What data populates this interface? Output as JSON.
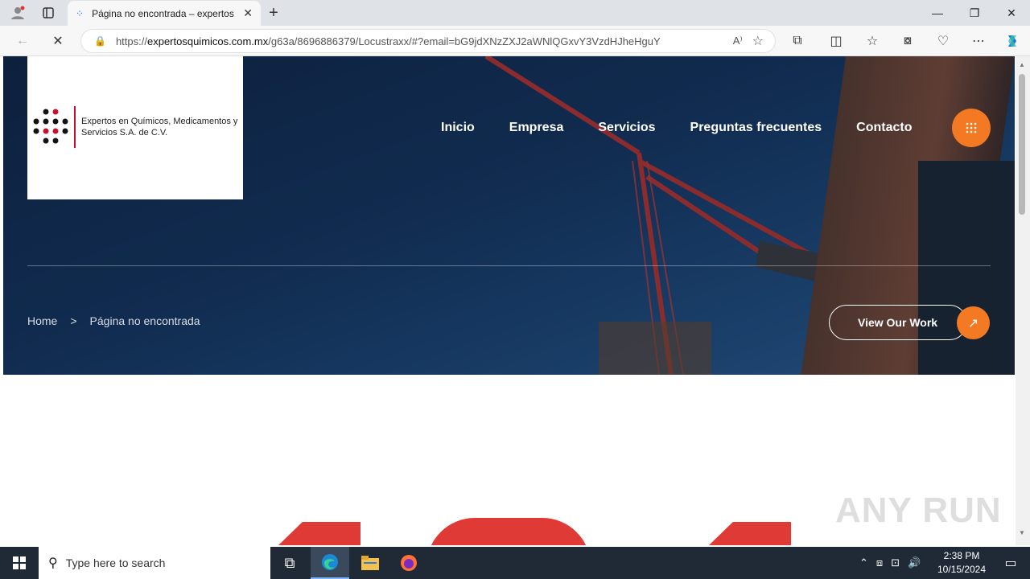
{
  "browser": {
    "tab_title": "Página no encontrada – expertos",
    "url_prefix": "https://",
    "url_domain": "expertosquimicos.com.mx",
    "url_path": "/g63a/8696886379/Locustraxx/#?email=bG9jdXNzZXJ2aWNlQGxvY3VzdHJheHguY",
    "read_aloud_label": "A⁾",
    "accent_color": "#1a73e8"
  },
  "site": {
    "logo_text": "Expertos en Químicos, Medicamentos y Servicios S.A. de C.V.",
    "nav": [
      "Inicio",
      "Empresa",
      "Servicios",
      "Preguntas frecuentes",
      "Contacto"
    ],
    "breadcrumb": {
      "home": "Home",
      "separator": ">",
      "current": "Página no encontrada"
    },
    "cta_label": "View Our Work",
    "accent_color": "#f37a23",
    "brand_red": "#c8102e"
  },
  "watermark": "ANY RUN",
  "taskbar": {
    "search_placeholder": "Type here to search",
    "time": "2:38 PM",
    "date": "10/15/2024"
  }
}
